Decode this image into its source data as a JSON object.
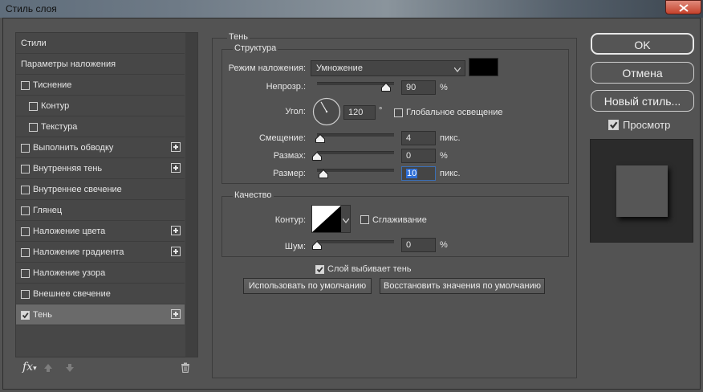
{
  "window": {
    "title": "Стиль слоя"
  },
  "sidebar": {
    "items": [
      {
        "label": "Стили",
        "checkbox": false,
        "plus": false,
        "indent": 0,
        "selected": false,
        "checked": false
      },
      {
        "label": "Параметры наложения",
        "checkbox": false,
        "plus": false,
        "indent": 0,
        "selected": false,
        "checked": false
      },
      {
        "label": "Тиснение",
        "checkbox": true,
        "plus": false,
        "indent": 0,
        "selected": false,
        "checked": false
      },
      {
        "label": "Контур",
        "checkbox": true,
        "plus": false,
        "indent": 1,
        "selected": false,
        "checked": false
      },
      {
        "label": "Текстура",
        "checkbox": true,
        "plus": false,
        "indent": 1,
        "selected": false,
        "checked": false
      },
      {
        "label": "Выполнить обводку",
        "checkbox": true,
        "plus": true,
        "indent": 0,
        "selected": false,
        "checked": false
      },
      {
        "label": "Внутренняя тень",
        "checkbox": true,
        "plus": true,
        "indent": 0,
        "selected": false,
        "checked": false
      },
      {
        "label": "Внутреннее свечение",
        "checkbox": true,
        "plus": false,
        "indent": 0,
        "selected": false,
        "checked": false
      },
      {
        "label": "Глянец",
        "checkbox": true,
        "plus": false,
        "indent": 0,
        "selected": false,
        "checked": false
      },
      {
        "label": "Наложение цвета",
        "checkbox": true,
        "plus": true,
        "indent": 0,
        "selected": false,
        "checked": false
      },
      {
        "label": "Наложение градиента",
        "checkbox": true,
        "plus": true,
        "indent": 0,
        "selected": false,
        "checked": false
      },
      {
        "label": "Наложение узора",
        "checkbox": true,
        "plus": false,
        "indent": 0,
        "selected": false,
        "checked": false
      },
      {
        "label": "Внешнее свечение",
        "checkbox": true,
        "plus": false,
        "indent": 0,
        "selected": false,
        "checked": false
      },
      {
        "label": "Тень",
        "checkbox": true,
        "plus": true,
        "indent": 0,
        "selected": true,
        "checked": true
      }
    ],
    "fx_label": "fx"
  },
  "panel": {
    "title": "Тень",
    "structure": {
      "title": "Структура",
      "blend_mode_label": "Режим наложения:",
      "blend_mode_value": "Умножение",
      "shadow_color": "#000000",
      "opacity_label": "Непрозр.:",
      "opacity_value": "90",
      "opacity_unit": "%",
      "opacity_level": 0.9,
      "angle_label": "Угол:",
      "angle_value": "120",
      "angle_unit": "°",
      "global_light_label": "Глобальное освещение",
      "global_light_checked": false,
      "distance_label": "Смещение:",
      "distance_value": "4",
      "distance_unit": "пикс.",
      "distance_level": 0.04,
      "spread_label": "Размах:",
      "spread_value": "0",
      "spread_unit": "%",
      "spread_level": 0,
      "size_label": "Размер:",
      "size_value": "10",
      "size_unit": "пикс.",
      "size_level": 0.08
    },
    "quality": {
      "title": "Качество",
      "contour_label": "Контур:",
      "antialias_label": "Сглаживание",
      "antialias_checked": false,
      "noise_label": "Шум:",
      "noise_value": "0",
      "noise_unit": "%",
      "noise_level": 0
    },
    "knockout_label": "Слой выбивает тень",
    "knockout_checked": true,
    "make_default_label": "Использовать по умолчанию",
    "reset_default_label": "Восстановить значения по умолчанию"
  },
  "right": {
    "ok_label": "OK",
    "cancel_label": "Отмена",
    "new_style_label": "Новый стиль...",
    "preview_label": "Просмотр",
    "preview_checked": true
  }
}
